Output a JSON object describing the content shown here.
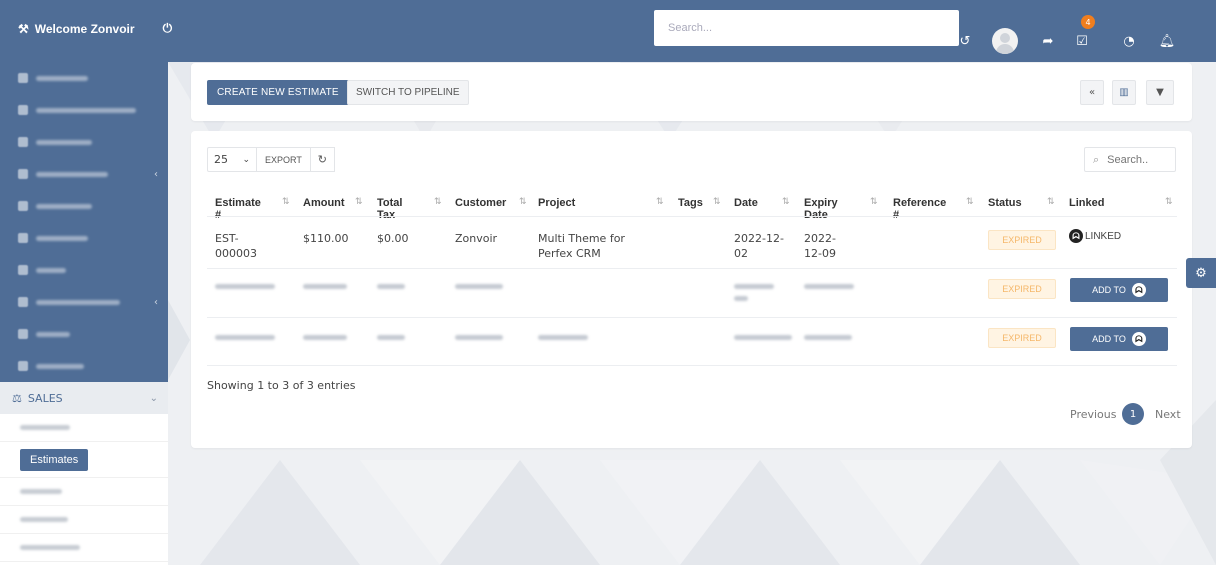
{
  "header": {
    "brand": "Welcome Zonvoir",
    "search_placeholder": "Search...",
    "notification_count": "4"
  },
  "sidebar": {
    "sales_label": "SALES",
    "active_sub": "Estimates"
  },
  "toolbar": {
    "create_label": "CREATE NEW ESTIMATE",
    "pipeline_label": "SWITCH TO PIPELINE"
  },
  "table_controls": {
    "page_size": "25",
    "export_label": "EXPORT",
    "search_placeholder": "Search.."
  },
  "table": {
    "columns": [
      "Estimate #",
      "Amount",
      "Total Tax",
      "Customer",
      "Project",
      "Tags",
      "Date",
      "Expiry Date",
      "Reference #",
      "Status",
      "Linked"
    ],
    "rows": [
      {
        "estimate": "EST-000003",
        "amount": "$110.00",
        "tax": "$0.00",
        "customer": "Zonvoir",
        "project": "Multi Theme for Perfex CRM",
        "date": "2022-12-02",
        "expiry": "2022-12-09",
        "status": "EXPIRED",
        "linked": "LINKED"
      }
    ],
    "row2_status": "EXPIRED",
    "row3_status": "EXPIRED",
    "add_to_label": "ADD TO"
  },
  "footer": {
    "info": "Showing 1 to 3 of 3 entries",
    "previous": "Previous",
    "current_page": "1",
    "next": "Next"
  },
  "colors": {
    "primary": "#4f6d96",
    "expired_bg": "#fff4e3",
    "expired_text": "#f5b76a",
    "badge": "#f07e1e"
  }
}
